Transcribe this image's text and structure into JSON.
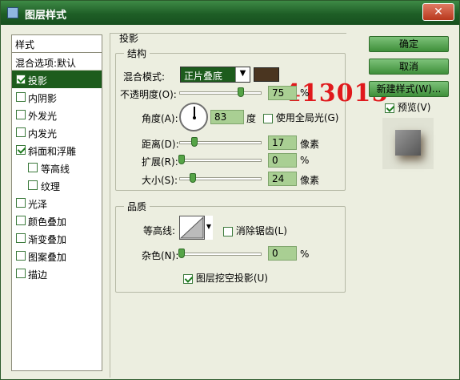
{
  "window": {
    "title": "图层样式",
    "close_glyph": "✕"
  },
  "style_list": {
    "header": "样式",
    "blend_options": "混合选项:默认",
    "items": [
      {
        "label": "投影",
        "checked": true,
        "selected": true,
        "sub": false
      },
      {
        "label": "内阴影",
        "checked": false,
        "selected": false,
        "sub": false
      },
      {
        "label": "外发光",
        "checked": false,
        "selected": false,
        "sub": false
      },
      {
        "label": "内发光",
        "checked": false,
        "selected": false,
        "sub": false
      },
      {
        "label": "斜面和浮雕",
        "checked": true,
        "selected": false,
        "sub": false
      },
      {
        "label": "等高线",
        "checked": false,
        "selected": false,
        "sub": true
      },
      {
        "label": "纹理",
        "checked": false,
        "selected": false,
        "sub": true
      },
      {
        "label": "光泽",
        "checked": false,
        "selected": false,
        "sub": false
      },
      {
        "label": "颜色叠加",
        "checked": false,
        "selected": false,
        "sub": false
      },
      {
        "label": "渐变叠加",
        "checked": false,
        "selected": false,
        "sub": false
      },
      {
        "label": "图案叠加",
        "checked": false,
        "selected": false,
        "sub": false
      },
      {
        "label": "描边",
        "checked": false,
        "selected": false,
        "sub": false
      }
    ]
  },
  "drop_shadow": {
    "section_title": "投影",
    "structure": {
      "title": "结构",
      "blend_mode_label": "混合模式:",
      "blend_mode_value": "正片叠底",
      "shadow_color": "#4a3520",
      "opacity_label": "不透明度(O):",
      "opacity_value": "75",
      "opacity_unit": "%",
      "opacity_level": 0.75,
      "angle_label": "角度(A):",
      "angle_value": "83",
      "angle_unit": "度",
      "global_light_label": "使用全局光(G)",
      "global_light_checked": false,
      "distance_label": "距离(D):",
      "distance_value": "17",
      "distance_unit": "像素",
      "spread_label": "扩展(R):",
      "spread_value": "0",
      "spread_unit": "%",
      "size_label": "大小(S):",
      "size_value": "24",
      "size_unit": "像素"
    },
    "quality": {
      "title": "品质",
      "contour_label": "等高线:",
      "anti_alias_label": "消除锯齿(L)",
      "anti_alias_checked": false,
      "noise_label": "杂色(N):",
      "noise_value": "0",
      "noise_unit": "%"
    },
    "knockout_label": "图层挖空投影(U)",
    "knockout_checked": true
  },
  "watermark": "413015",
  "buttons": {
    "ok": "确定",
    "cancel": "取消",
    "new_style": "新建样式(W)...",
    "preview_label": "预览(V)",
    "preview_checked": true
  }
}
